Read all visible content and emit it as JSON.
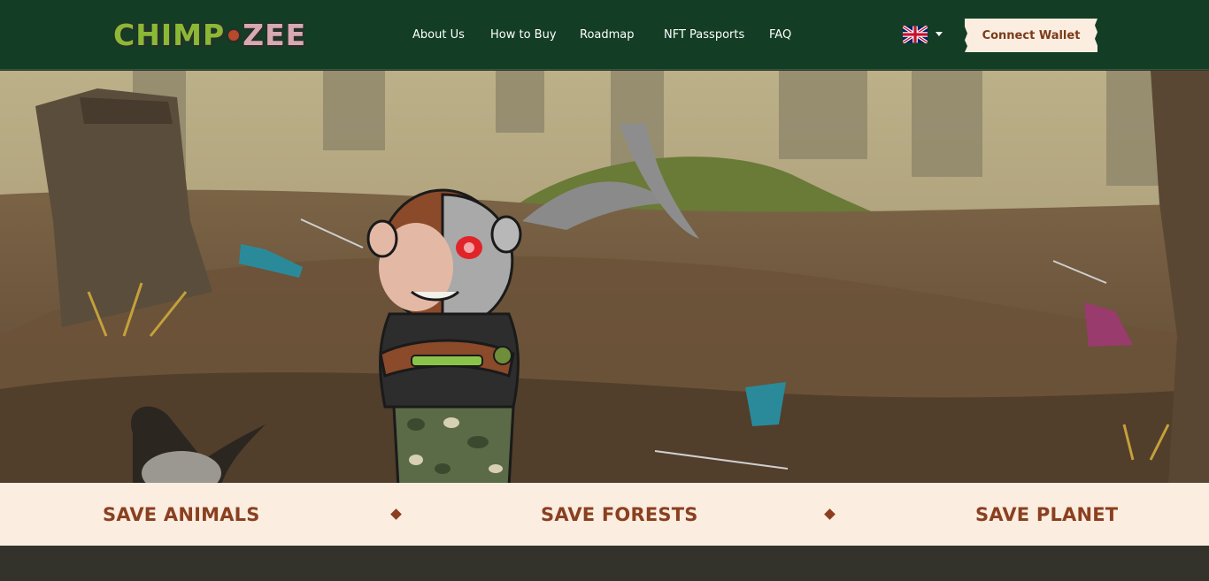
{
  "header": {
    "logo_part1": "CHIMP",
    "logo_part2": "ZEE",
    "nav": [
      "About Us",
      "How to Buy",
      "Roadmap",
      "NFT Passports",
      "FAQ"
    ],
    "language_icon": "uk-flag-icon",
    "connect_wallet_label": "Connect Wallet"
  },
  "banner": {
    "slogans": [
      "SAVE ANIMALS",
      "SAVE FORESTS",
      "SAVE PLANET"
    ]
  },
  "colors": {
    "header_bg": "#133d24",
    "banner_bg": "#fbede0",
    "slogan_text": "#8a4020",
    "button_bg": "#fbeee0",
    "button_text": "#7a3b1c"
  }
}
